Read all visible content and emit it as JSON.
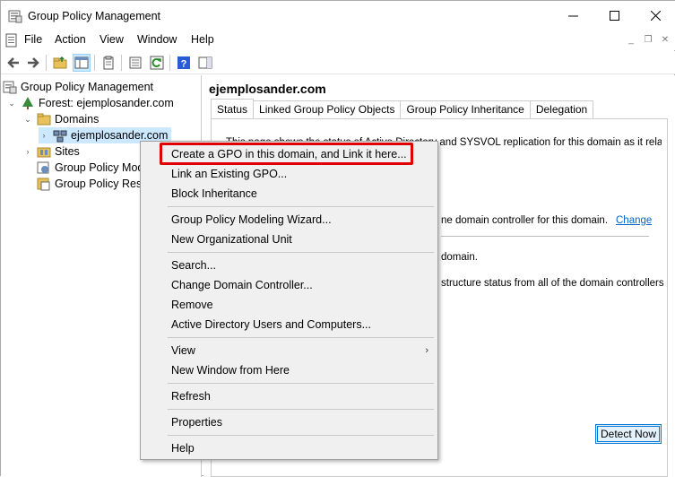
{
  "window": {
    "title": "Group Policy Management",
    "controls": {
      "minimize": "—",
      "maximize": "☐",
      "close": "✕"
    }
  },
  "menubar": {
    "items": [
      "File",
      "Action",
      "View",
      "Window",
      "Help"
    ],
    "mdi": {
      "minimize": "_",
      "restore": "❐",
      "close": "✕"
    }
  },
  "toolbar": {
    "icons": [
      "back-icon",
      "forward-icon",
      "up-folder-icon",
      "show-hide-tree-icon",
      "properties-icon",
      "export-list-icon",
      "refresh-icon",
      "help-icon",
      "action-pane-icon"
    ]
  },
  "tree": {
    "root": "Group Policy Management",
    "forest": "Forest: ejemplosander.com",
    "domains": "Domains",
    "domain": "ejemplosander.com",
    "sites": "Sites",
    "modeling": "Group Policy Mod",
    "results": "Group Policy Resu"
  },
  "main": {
    "title": "ejemplosander.com",
    "tabs": [
      "Status",
      "Linked Group Policy Objects",
      "Group Policy Inheritance",
      "Delegation"
    ],
    "status_line1": "This page shows the status of Active Directory and SYSVOL replication for this domain as it relates to",
    "status_line2": "ne domain controller for this domain.",
    "change_link": "Change",
    "status_line3": "domain.",
    "status_line4": "structure status from all of the domain controllers",
    "detect_button": "Detect Now"
  },
  "context_menu": {
    "items": [
      "Create a GPO in this domain, and Link it here...",
      "Link an Existing GPO...",
      "Block Inheritance",
      "Group Policy Modeling Wizard...",
      "New Organizational Unit",
      "Search...",
      "Change Domain Controller...",
      "Remove",
      "Active Directory Users and Computers...",
      "View",
      "New Window from Here",
      "Refresh",
      "Properties",
      "Help"
    ],
    "submenu_arrow": "›"
  },
  "colors": {
    "highlight": "#e00000",
    "selection": "#cce8ff",
    "link": "#0066cc",
    "button_border": "#0078d7"
  }
}
